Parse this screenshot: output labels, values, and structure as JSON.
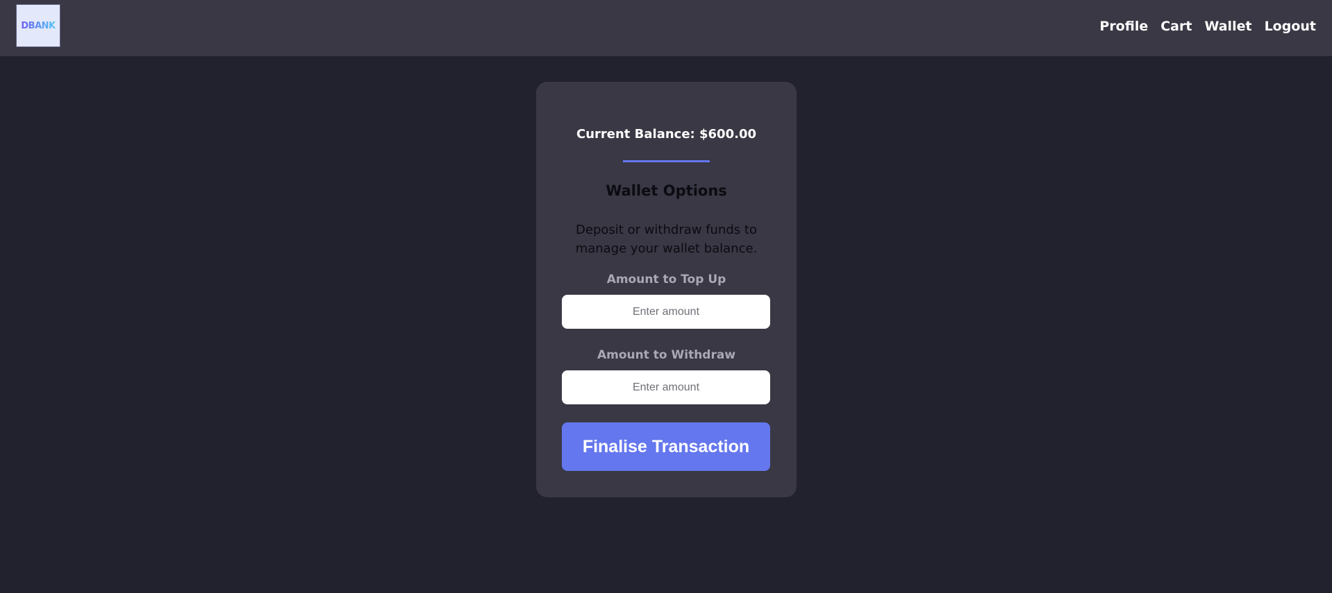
{
  "header": {
    "logo_text": "DBANK",
    "nav": [
      "Profile",
      "Cart",
      "Wallet",
      "Logout"
    ]
  },
  "wallet": {
    "balance_text": "Current Balance: $600.00",
    "options_title": "Wallet Options",
    "description": "Deposit or withdraw funds to manage your wallet balance.",
    "topup_label": "Amount to Top Up",
    "topup_placeholder": "Enter amount",
    "topup_value": "",
    "withdraw_label": "Amount to Withdraw",
    "withdraw_placeholder": "Enter amount",
    "withdraw_value": "",
    "submit_label": "Finalise Transaction"
  },
  "colors": {
    "page_background": "#22212e",
    "surface": "#393844",
    "accent": "#6577ee"
  }
}
